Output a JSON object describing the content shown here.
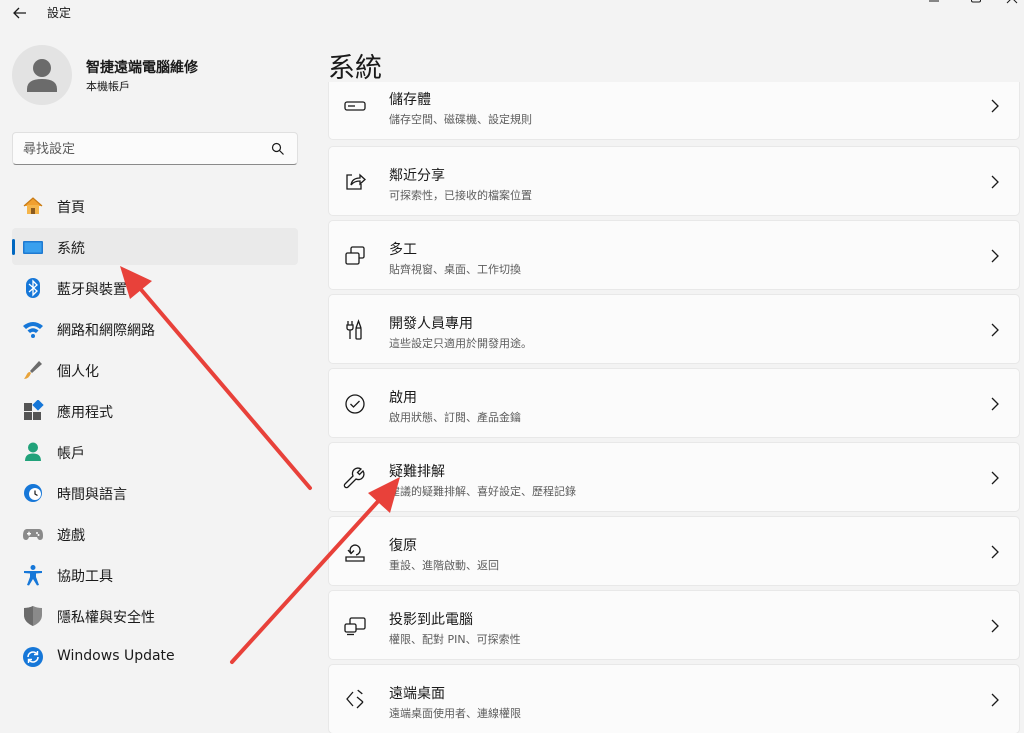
{
  "window": {
    "title": "設定",
    "back_icon": "back-arrow-icon",
    "controls": [
      "minimize-icon",
      "maximize-icon",
      "close-icon"
    ]
  },
  "profile": {
    "name": "智捷遠端電腦維修",
    "account_type": "本機帳戶",
    "avatar_icon": "person-icon"
  },
  "search": {
    "placeholder": "尋找設定",
    "icon": "search-icon"
  },
  "sidebar": {
    "items": [
      {
        "label": "首頁",
        "icon": "home-icon",
        "active": false
      },
      {
        "label": "系統",
        "icon": "system-icon",
        "active": true
      },
      {
        "label": "藍牙與裝置",
        "icon": "bluetooth-icon",
        "active": false
      },
      {
        "label": "網路和網際網路",
        "icon": "wifi-icon",
        "active": false
      },
      {
        "label": "個人化",
        "icon": "brush-icon",
        "active": false
      },
      {
        "label": "應用程式",
        "icon": "apps-icon",
        "active": false
      },
      {
        "label": "帳戶",
        "icon": "account-icon",
        "active": false
      },
      {
        "label": "時間與語言",
        "icon": "clock-globe-icon",
        "active": false
      },
      {
        "label": "遊戲",
        "icon": "gamepad-icon",
        "active": false
      },
      {
        "label": "協助工具",
        "icon": "accessibility-icon",
        "active": false
      },
      {
        "label": "隱私權與安全性",
        "icon": "shield-icon",
        "active": false
      },
      {
        "label": "Windows Update",
        "icon": "update-icon",
        "active": false
      }
    ]
  },
  "main": {
    "title": "系統",
    "cards": [
      {
        "title": "儲存體",
        "subtitle": "儲存空間、磁碟機、設定規則",
        "icon": "storage-drive-icon"
      },
      {
        "title": "鄰近分享",
        "subtitle": "可探索性，已接收的檔案位置",
        "icon": "share-icon"
      },
      {
        "title": "多工",
        "subtitle": "貼齊視窗、桌面、工作切換",
        "icon": "multitask-icon"
      },
      {
        "title": "開發人員專用",
        "subtitle": "這些設定只適用於開發用途。",
        "icon": "developer-tools-icon"
      },
      {
        "title": "啟用",
        "subtitle": "啟用狀態、訂閱、產品金鑰",
        "icon": "check-circle-icon"
      },
      {
        "title": "疑難排解",
        "subtitle": "建議的疑難排解、喜好設定、歷程記錄",
        "icon": "wrench-icon"
      },
      {
        "title": "復原",
        "subtitle": "重設、進階啟動、返回",
        "icon": "recovery-icon"
      },
      {
        "title": "投影到此電腦",
        "subtitle": "權限、配對 PIN、可探索性",
        "icon": "project-pc-icon"
      },
      {
        "title": "遠端桌面",
        "subtitle": "遠端桌面使用者、連線權限",
        "icon": "remote-desktop-icon"
      }
    ]
  },
  "colors": {
    "background": "#f3f3f3",
    "card": "#fbfbfb",
    "accent": "#0067c0",
    "annotation_arrow": "#e8413a"
  }
}
